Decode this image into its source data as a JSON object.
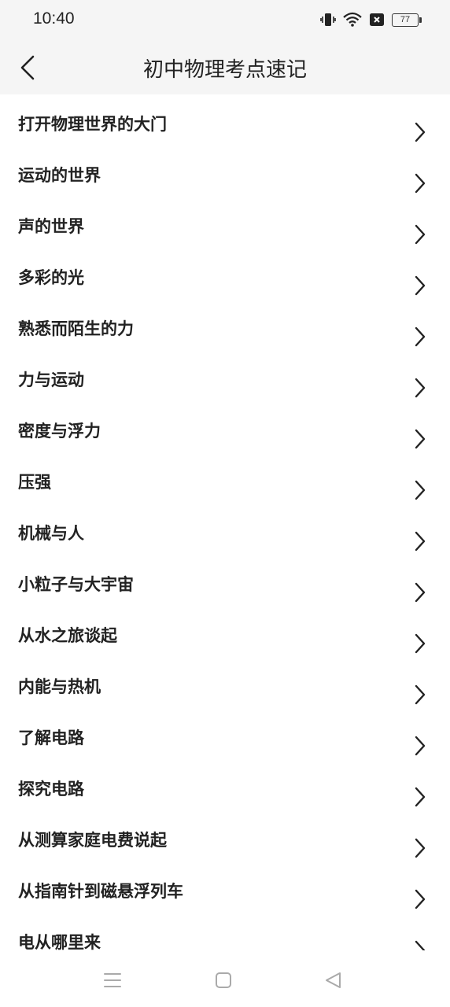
{
  "status_bar": {
    "time": "10:40",
    "battery": "77",
    "icons": [
      "vibrate-icon",
      "wifi-icon",
      "notification-x-icon",
      "battery-icon"
    ]
  },
  "header": {
    "back_icon": "chevron-left-icon",
    "title": "初中物理考点速记"
  },
  "list": {
    "items": [
      {
        "label": "打开物理世界的大门"
      },
      {
        "label": "运动的世界"
      },
      {
        "label": "声的世界"
      },
      {
        "label": "多彩的光"
      },
      {
        "label": "熟悉而陌生的力"
      },
      {
        "label": "力与运动"
      },
      {
        "label": "密度与浮力"
      },
      {
        "label": "压强"
      },
      {
        "label": "机械与人"
      },
      {
        "label": "小粒子与大宇宙"
      },
      {
        "label": "从水之旅谈起"
      },
      {
        "label": "内能与热机"
      },
      {
        "label": "了解电路"
      },
      {
        "label": "探究电路"
      },
      {
        "label": "从测算家庭电费说起"
      },
      {
        "label": "从指南针到磁悬浮列车"
      },
      {
        "label": "电从哪里来"
      }
    ],
    "chevron_icon": "chevron-right-icon"
  },
  "nav_bar": {
    "icons": [
      "menu-icon",
      "home-square-icon",
      "back-triangle-icon"
    ]
  }
}
